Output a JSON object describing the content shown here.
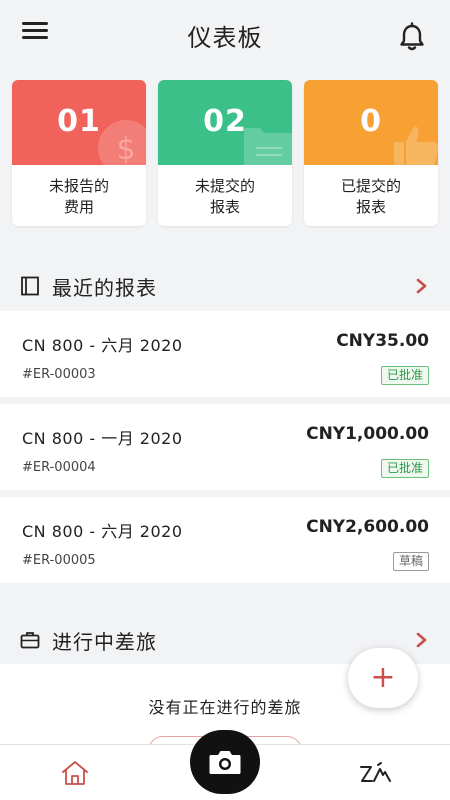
{
  "header": {
    "title": "仪表板",
    "menu_icon": "hamburger-menu-icon",
    "bell_icon": "bell-icon"
  },
  "summary_cards": [
    {
      "count": "01",
      "label_line1": "未报告的",
      "label_line2": "费用",
      "color": "#f1625a",
      "deco_icon": "coin-icon"
    },
    {
      "count": "02",
      "label_line1": "未提交的",
      "label_line2": "报表",
      "color": "#3cc08a",
      "deco_icon": "folder-icon"
    },
    {
      "count": "0",
      "label_line1": "已提交的",
      "label_line2": "报表",
      "color": "#f7a134",
      "deco_icon": "thumbs-up-icon"
    }
  ],
  "recent_reports": {
    "title": "最近的报表",
    "items": [
      {
        "name": "CN 800 - 六月 2020",
        "amount": "CNY35.00",
        "id": "#ER-00003",
        "status": "已批准"
      },
      {
        "name": "CN 800 - 一月 2020",
        "amount": "CNY1,000.00",
        "id": "#ER-00004",
        "status": "已批准"
      },
      {
        "name": "CN 800 - 六月 2020",
        "amount": "CNY2,600.00",
        "id": "#ER-00005",
        "status": "草稿"
      }
    ]
  },
  "trips": {
    "title": "进行中差旅",
    "empty_text": "没有正在进行的差旅"
  },
  "fab": {
    "label": "+"
  },
  "bottom_nav": {
    "home_icon": "home-icon",
    "camera_icon": "camera-icon",
    "trip_icon": "trip-icon"
  },
  "colors": {
    "accent": "#c8504b",
    "approved": "#2e9a4a"
  }
}
